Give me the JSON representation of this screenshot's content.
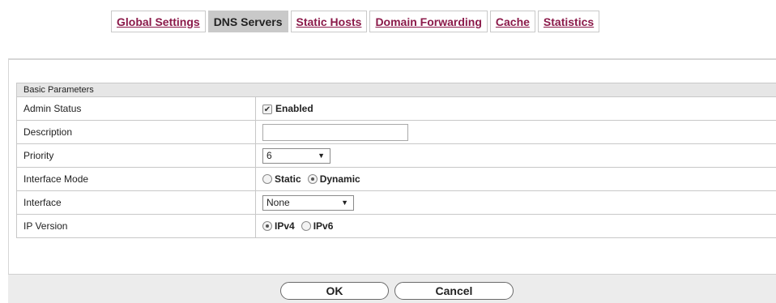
{
  "tabs": [
    {
      "label": "Global Settings",
      "active": false
    },
    {
      "label": "DNS Servers",
      "active": true
    },
    {
      "label": "Static Hosts",
      "active": false
    },
    {
      "label": "Domain Forwarding",
      "active": false
    },
    {
      "label": "Cache",
      "active": false
    },
    {
      "label": "Statistics",
      "active": false
    }
  ],
  "section": {
    "title": "Basic Parameters"
  },
  "fields": {
    "admin_status": {
      "label": "Admin Status",
      "checkbox_label": "Enabled",
      "checked": true
    },
    "description": {
      "label": "Description",
      "value": ""
    },
    "priority": {
      "label": "Priority",
      "value": "6"
    },
    "interface_mode": {
      "label": "Interface Mode",
      "options": [
        "Static",
        "Dynamic"
      ],
      "selected": "Dynamic"
    },
    "interface": {
      "label": "Interface",
      "value": "None"
    },
    "ip_version": {
      "label": "IP Version",
      "options": [
        "IPv4",
        "IPv6"
      ],
      "selected": "IPv4"
    }
  },
  "buttons": {
    "ok": "OK",
    "cancel": "Cancel"
  },
  "icons": {
    "dropdown": "caret-down-icon",
    "check": "checkmark-icon"
  }
}
